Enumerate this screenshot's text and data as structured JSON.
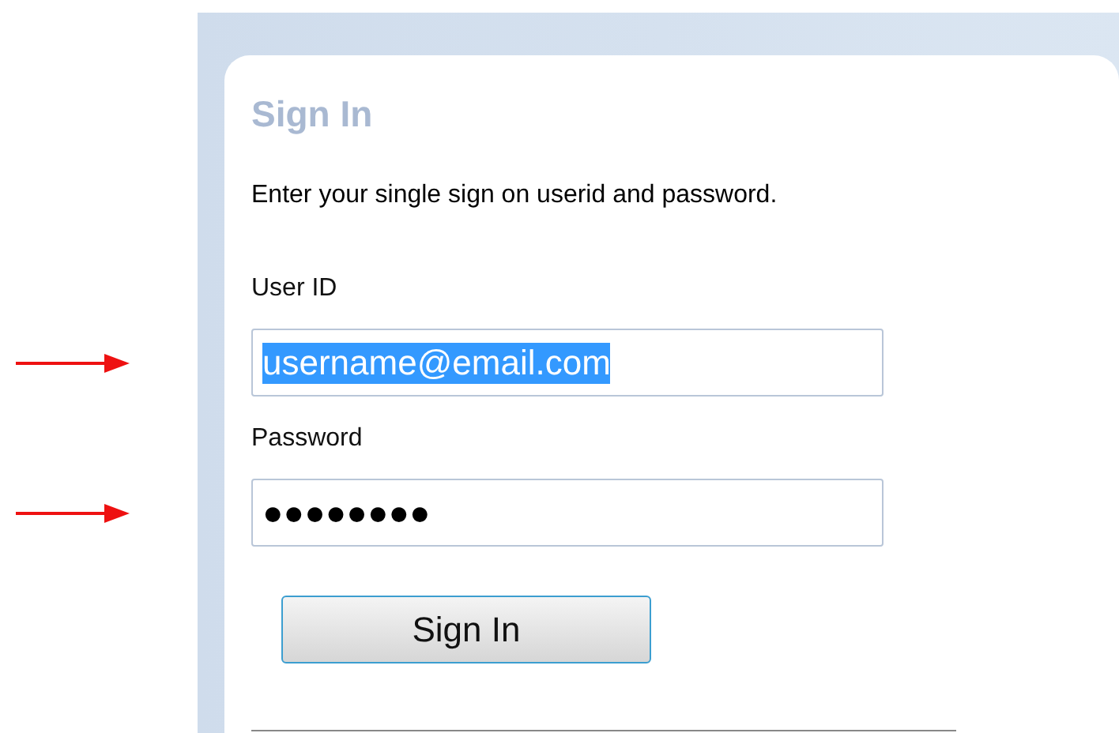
{
  "title": "Sign In",
  "instructions": "Enter your single sign on userid and password.",
  "fields": [
    {
      "label": "User ID",
      "value": "username@email.com",
      "selected": true,
      "arrow": true
    },
    {
      "label": "Password",
      "value": "●●●●●●●●",
      "selected": false,
      "arrow": true
    }
  ],
  "button": "Sign In"
}
